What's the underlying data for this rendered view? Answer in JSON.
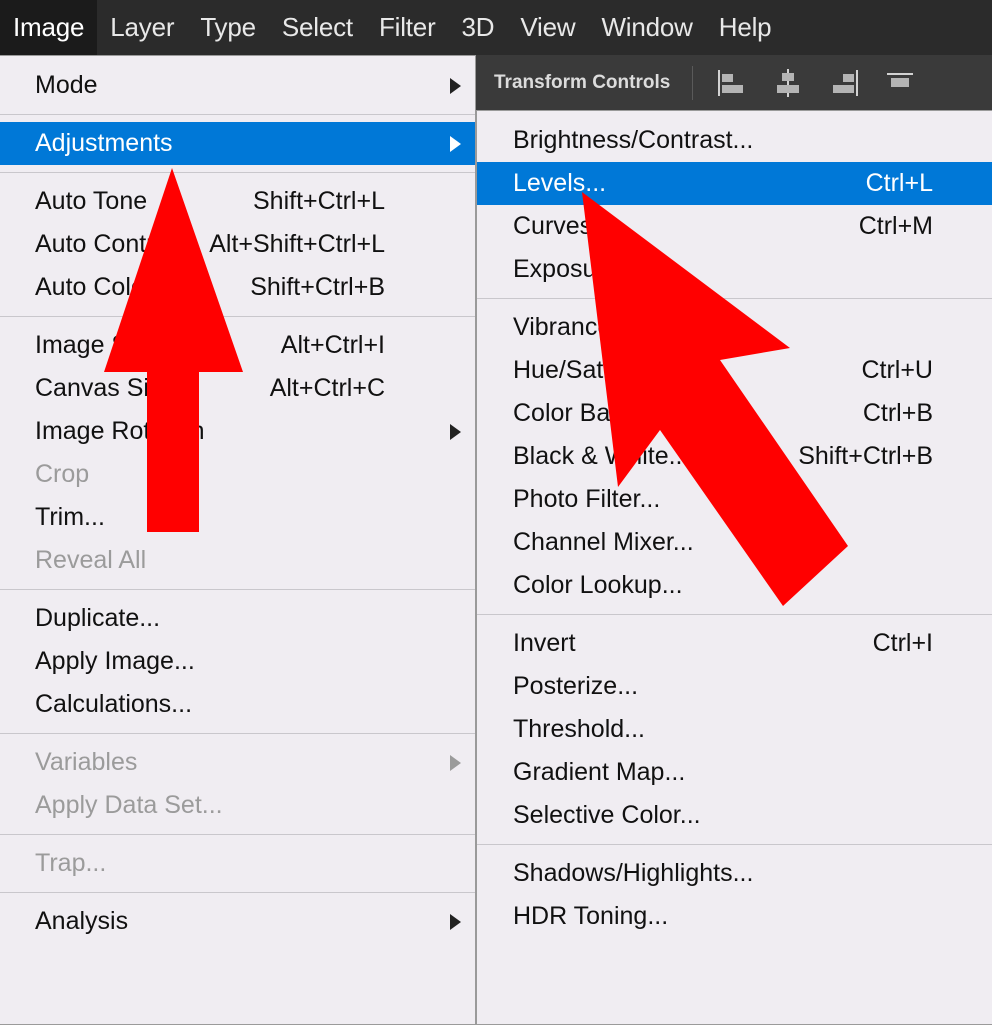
{
  "app": {
    "accent_blue": "#0078D7",
    "menu_background": "#F0EDF2",
    "toolbar_background": "#2B2B2B",
    "arrow_color": "#FF0000"
  },
  "menubar": {
    "items": [
      {
        "label": "Image",
        "active": true
      },
      {
        "label": "Layer",
        "active": false
      },
      {
        "label": "Type",
        "active": false
      },
      {
        "label": "Select",
        "active": false
      },
      {
        "label": "Filter",
        "active": false
      },
      {
        "label": "3D",
        "active": false
      },
      {
        "label": "View",
        "active": false
      },
      {
        "label": "Window",
        "active": false
      },
      {
        "label": "Help",
        "active": false
      }
    ]
  },
  "options_bar": {
    "transform_controls_label": "Transform Controls",
    "align_icons": [
      "align-left-edges-icon",
      "align-horizontal-centers-icon",
      "align-right-edges-icon",
      "align-top-edges-icon"
    ]
  },
  "image_menu": {
    "groups": [
      {
        "items": [
          {
            "label": "Mode",
            "shortcut": "",
            "submenu": true,
            "disabled": false,
            "selected": false
          }
        ]
      },
      {
        "items": [
          {
            "label": "Adjustments",
            "shortcut": "",
            "submenu": true,
            "disabled": false,
            "selected": true
          }
        ]
      },
      {
        "items": [
          {
            "label": "Auto Tone",
            "shortcut": "Shift+Ctrl+L",
            "submenu": false,
            "disabled": false,
            "selected": false
          },
          {
            "label": "Auto Contrast",
            "shortcut": "Alt+Shift+Ctrl+L",
            "submenu": false,
            "disabled": false,
            "selected": false
          },
          {
            "label": "Auto Color",
            "shortcut": "Shift+Ctrl+B",
            "submenu": false,
            "disabled": false,
            "selected": false
          }
        ]
      },
      {
        "items": [
          {
            "label": "Image Size...",
            "shortcut": "Alt+Ctrl+I",
            "submenu": false,
            "disabled": false,
            "selected": false
          },
          {
            "label": "Canvas Size...",
            "shortcut": "Alt+Ctrl+C",
            "submenu": false,
            "disabled": false,
            "selected": false
          },
          {
            "label": "Image Rotation",
            "shortcut": "",
            "submenu": true,
            "disabled": false,
            "selected": false
          },
          {
            "label": "Crop",
            "shortcut": "",
            "submenu": false,
            "disabled": true,
            "selected": false
          },
          {
            "label": "Trim...",
            "shortcut": "",
            "submenu": false,
            "disabled": false,
            "selected": false
          },
          {
            "label": "Reveal All",
            "shortcut": "",
            "submenu": false,
            "disabled": true,
            "selected": false
          }
        ]
      },
      {
        "items": [
          {
            "label": "Duplicate...",
            "shortcut": "",
            "submenu": false,
            "disabled": false,
            "selected": false
          },
          {
            "label": "Apply Image...",
            "shortcut": "",
            "submenu": false,
            "disabled": false,
            "selected": false
          },
          {
            "label": "Calculations...",
            "shortcut": "",
            "submenu": false,
            "disabled": false,
            "selected": false
          }
        ]
      },
      {
        "items": [
          {
            "label": "Variables",
            "shortcut": "",
            "submenu": true,
            "disabled": true,
            "selected": false
          },
          {
            "label": "Apply Data Set...",
            "shortcut": "",
            "submenu": false,
            "disabled": true,
            "selected": false
          }
        ]
      },
      {
        "items": [
          {
            "label": "Trap...",
            "shortcut": "",
            "submenu": false,
            "disabled": true,
            "selected": false
          }
        ]
      },
      {
        "items": [
          {
            "label": "Analysis",
            "shortcut": "",
            "submenu": true,
            "disabled": false,
            "selected": false
          }
        ]
      }
    ]
  },
  "adjustments_submenu": {
    "groups": [
      {
        "items": [
          {
            "label": "Brightness/Contrast...",
            "shortcut": "",
            "submenu": false,
            "disabled": false,
            "selected": false
          },
          {
            "label": "Levels...",
            "shortcut": "Ctrl+L",
            "submenu": false,
            "disabled": false,
            "selected": true
          },
          {
            "label": "Curves...",
            "shortcut": "Ctrl+M",
            "submenu": false,
            "disabled": false,
            "selected": false
          },
          {
            "label": "Exposure...",
            "shortcut": "",
            "submenu": false,
            "disabled": false,
            "selected": false
          }
        ]
      },
      {
        "items": [
          {
            "label": "Vibrance...",
            "shortcut": "",
            "submenu": false,
            "disabled": false,
            "selected": false
          },
          {
            "label": "Hue/Saturation...",
            "shortcut": "Ctrl+U",
            "submenu": false,
            "disabled": false,
            "selected": false
          },
          {
            "label": "Color Balance...",
            "shortcut": "Ctrl+B",
            "submenu": false,
            "disabled": false,
            "selected": false
          },
          {
            "label": "Black & White...",
            "shortcut": "Shift+Ctrl+B",
            "submenu": false,
            "disabled": false,
            "selected": false
          },
          {
            "label": "Photo Filter...",
            "shortcut": "",
            "submenu": false,
            "disabled": false,
            "selected": false
          },
          {
            "label": "Channel Mixer...",
            "shortcut": "",
            "submenu": false,
            "disabled": false,
            "selected": false
          },
          {
            "label": "Color Lookup...",
            "shortcut": "",
            "submenu": false,
            "disabled": false,
            "selected": false
          }
        ]
      },
      {
        "items": [
          {
            "label": "Invert",
            "shortcut": "Ctrl+I",
            "submenu": false,
            "disabled": false,
            "selected": false
          },
          {
            "label": "Posterize...",
            "shortcut": "",
            "submenu": false,
            "disabled": false,
            "selected": false
          },
          {
            "label": "Threshold...",
            "shortcut": "",
            "submenu": false,
            "disabled": false,
            "selected": false
          },
          {
            "label": "Gradient Map...",
            "shortcut": "",
            "submenu": false,
            "disabled": false,
            "selected": false
          },
          {
            "label": "Selective Color...",
            "shortcut": "",
            "submenu": false,
            "disabled": false,
            "selected": false
          }
        ]
      },
      {
        "items": [
          {
            "label": "Shadows/Highlights...",
            "shortcut": "",
            "submenu": false,
            "disabled": false,
            "selected": false
          },
          {
            "label": "HDR Toning...",
            "shortcut": "",
            "submenu": false,
            "disabled": false,
            "selected": false
          }
        ]
      }
    ]
  },
  "annotations": {
    "arrows": [
      {
        "name": "arrow-pointing-to-adjustments",
        "direction": "up"
      },
      {
        "name": "arrow-pointing-to-levels",
        "direction": "up-left"
      }
    ]
  }
}
